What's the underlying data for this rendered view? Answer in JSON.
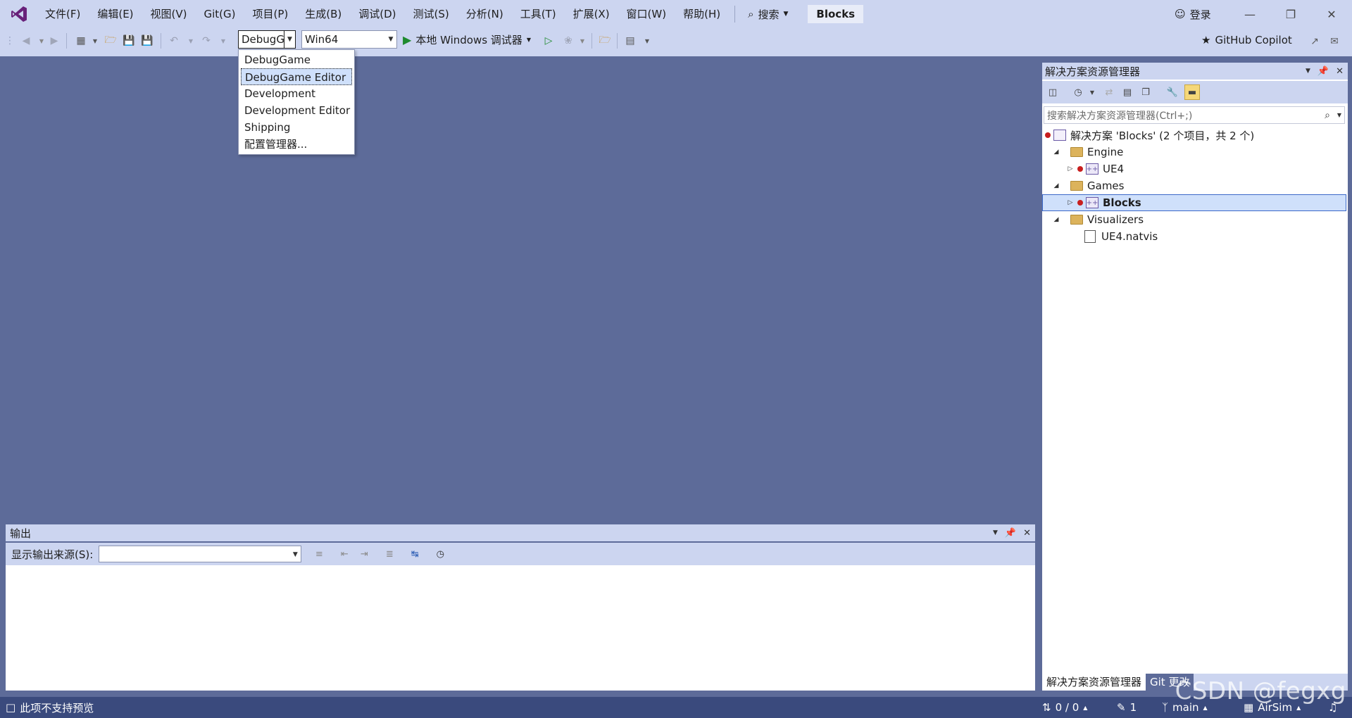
{
  "menubar": {
    "items": [
      "文件(F)",
      "编辑(E)",
      "视图(V)",
      "Git(G)",
      "项目(P)",
      "生成(B)",
      "调试(D)",
      "测试(S)",
      "分析(N)",
      "工具(T)",
      "扩展(X)",
      "窗口(W)",
      "帮助(H)"
    ],
    "search_label": "搜索",
    "solution_name": "Blocks",
    "login_label": "登录"
  },
  "toolbar": {
    "config_value": "DebugG",
    "platform_value": "Win64",
    "run_label": "本地 Windows 调试器",
    "copilot_label": "GitHub Copilot"
  },
  "config_dropdown": {
    "options": [
      "DebugGame",
      "DebugGame Editor",
      "Development",
      "Development Editor",
      "Shipping",
      "配置管理器..."
    ],
    "selected": "DebugGame Editor"
  },
  "solution_explorer": {
    "title": "解决方案资源管理器",
    "search_placeholder": "搜索解决方案资源管理器(Ctrl+;)",
    "tree": {
      "solution": "解决方案 'Blocks' (2 个项目，共 2 个)",
      "folder_engine": "Engine",
      "proj_ue4": "UE4",
      "folder_games": "Games",
      "proj_blocks": "Blocks",
      "folder_visualizers": "Visualizers",
      "file_natvis": "UE4.natvis"
    },
    "tabs": [
      "解决方案资源管理器",
      "Git 更改"
    ]
  },
  "output": {
    "title": "输出",
    "source_label": "显示输出来源(S):",
    "source_value": ""
  },
  "statusbar": {
    "message": "此项不支持预览",
    "sync": "0 / 0",
    "edits": "1",
    "branch": "main",
    "repo": "AirSim"
  },
  "watermark": "CSDN @fegxg",
  "colors": {
    "background": "#5d6b99",
    "chrome": "#ccd5f0",
    "statusbar": "#3a4a7d",
    "selection": "#cfe0fb",
    "accent_purple": "#68217a",
    "run_green": "#1e8a2e"
  }
}
